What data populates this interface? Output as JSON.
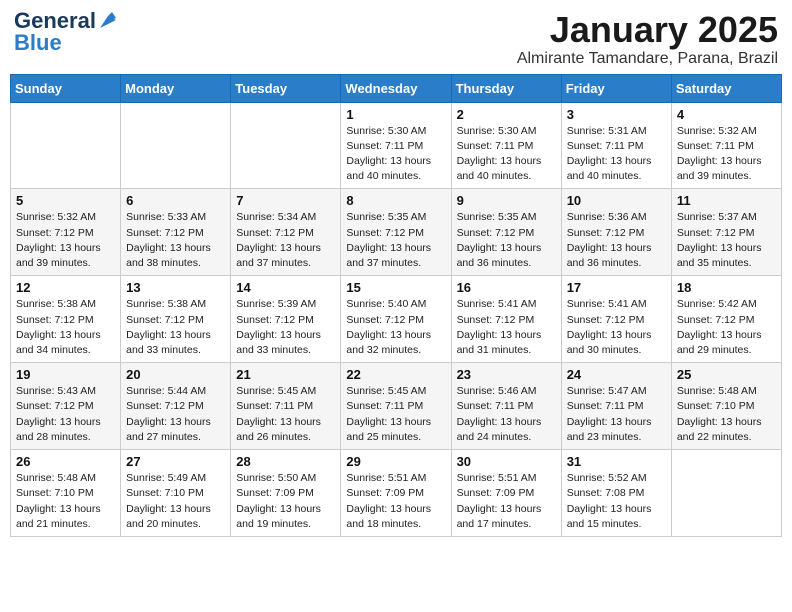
{
  "header": {
    "logo": {
      "general": "General",
      "blue": "Blue"
    },
    "title": "January 2025",
    "location": "Almirante Tamandare, Parana, Brazil"
  },
  "weekdays": [
    "Sunday",
    "Monday",
    "Tuesday",
    "Wednesday",
    "Thursday",
    "Friday",
    "Saturday"
  ],
  "weeks": [
    [
      {
        "day": "",
        "sunrise": "",
        "sunset": "",
        "daylight": ""
      },
      {
        "day": "",
        "sunrise": "",
        "sunset": "",
        "daylight": ""
      },
      {
        "day": "",
        "sunrise": "",
        "sunset": "",
        "daylight": ""
      },
      {
        "day": "1",
        "sunrise": "Sunrise: 5:30 AM",
        "sunset": "Sunset: 7:11 PM",
        "daylight": "Daylight: 13 hours and 40 minutes."
      },
      {
        "day": "2",
        "sunrise": "Sunrise: 5:30 AM",
        "sunset": "Sunset: 7:11 PM",
        "daylight": "Daylight: 13 hours and 40 minutes."
      },
      {
        "day": "3",
        "sunrise": "Sunrise: 5:31 AM",
        "sunset": "Sunset: 7:11 PM",
        "daylight": "Daylight: 13 hours and 40 minutes."
      },
      {
        "day": "4",
        "sunrise": "Sunrise: 5:32 AM",
        "sunset": "Sunset: 7:11 PM",
        "daylight": "Daylight: 13 hours and 39 minutes."
      }
    ],
    [
      {
        "day": "5",
        "sunrise": "Sunrise: 5:32 AM",
        "sunset": "Sunset: 7:12 PM",
        "daylight": "Daylight: 13 hours and 39 minutes."
      },
      {
        "day": "6",
        "sunrise": "Sunrise: 5:33 AM",
        "sunset": "Sunset: 7:12 PM",
        "daylight": "Daylight: 13 hours and 38 minutes."
      },
      {
        "day": "7",
        "sunrise": "Sunrise: 5:34 AM",
        "sunset": "Sunset: 7:12 PM",
        "daylight": "Daylight: 13 hours and 37 minutes."
      },
      {
        "day": "8",
        "sunrise": "Sunrise: 5:35 AM",
        "sunset": "Sunset: 7:12 PM",
        "daylight": "Daylight: 13 hours and 37 minutes."
      },
      {
        "day": "9",
        "sunrise": "Sunrise: 5:35 AM",
        "sunset": "Sunset: 7:12 PM",
        "daylight": "Daylight: 13 hours and 36 minutes."
      },
      {
        "day": "10",
        "sunrise": "Sunrise: 5:36 AM",
        "sunset": "Sunset: 7:12 PM",
        "daylight": "Daylight: 13 hours and 36 minutes."
      },
      {
        "day": "11",
        "sunrise": "Sunrise: 5:37 AM",
        "sunset": "Sunset: 7:12 PM",
        "daylight": "Daylight: 13 hours and 35 minutes."
      }
    ],
    [
      {
        "day": "12",
        "sunrise": "Sunrise: 5:38 AM",
        "sunset": "Sunset: 7:12 PM",
        "daylight": "Daylight: 13 hours and 34 minutes."
      },
      {
        "day": "13",
        "sunrise": "Sunrise: 5:38 AM",
        "sunset": "Sunset: 7:12 PM",
        "daylight": "Daylight: 13 hours and 33 minutes."
      },
      {
        "day": "14",
        "sunrise": "Sunrise: 5:39 AM",
        "sunset": "Sunset: 7:12 PM",
        "daylight": "Daylight: 13 hours and 33 minutes."
      },
      {
        "day": "15",
        "sunrise": "Sunrise: 5:40 AM",
        "sunset": "Sunset: 7:12 PM",
        "daylight": "Daylight: 13 hours and 32 minutes."
      },
      {
        "day": "16",
        "sunrise": "Sunrise: 5:41 AM",
        "sunset": "Sunset: 7:12 PM",
        "daylight": "Daylight: 13 hours and 31 minutes."
      },
      {
        "day": "17",
        "sunrise": "Sunrise: 5:41 AM",
        "sunset": "Sunset: 7:12 PM",
        "daylight": "Daylight: 13 hours and 30 minutes."
      },
      {
        "day": "18",
        "sunrise": "Sunrise: 5:42 AM",
        "sunset": "Sunset: 7:12 PM",
        "daylight": "Daylight: 13 hours and 29 minutes."
      }
    ],
    [
      {
        "day": "19",
        "sunrise": "Sunrise: 5:43 AM",
        "sunset": "Sunset: 7:12 PM",
        "daylight": "Daylight: 13 hours and 28 minutes."
      },
      {
        "day": "20",
        "sunrise": "Sunrise: 5:44 AM",
        "sunset": "Sunset: 7:12 PM",
        "daylight": "Daylight: 13 hours and 27 minutes."
      },
      {
        "day": "21",
        "sunrise": "Sunrise: 5:45 AM",
        "sunset": "Sunset: 7:11 PM",
        "daylight": "Daylight: 13 hours and 26 minutes."
      },
      {
        "day": "22",
        "sunrise": "Sunrise: 5:45 AM",
        "sunset": "Sunset: 7:11 PM",
        "daylight": "Daylight: 13 hours and 25 minutes."
      },
      {
        "day": "23",
        "sunrise": "Sunrise: 5:46 AM",
        "sunset": "Sunset: 7:11 PM",
        "daylight": "Daylight: 13 hours and 24 minutes."
      },
      {
        "day": "24",
        "sunrise": "Sunrise: 5:47 AM",
        "sunset": "Sunset: 7:11 PM",
        "daylight": "Daylight: 13 hours and 23 minutes."
      },
      {
        "day": "25",
        "sunrise": "Sunrise: 5:48 AM",
        "sunset": "Sunset: 7:10 PM",
        "daylight": "Daylight: 13 hours and 22 minutes."
      }
    ],
    [
      {
        "day": "26",
        "sunrise": "Sunrise: 5:48 AM",
        "sunset": "Sunset: 7:10 PM",
        "daylight": "Daylight: 13 hours and 21 minutes."
      },
      {
        "day": "27",
        "sunrise": "Sunrise: 5:49 AM",
        "sunset": "Sunset: 7:10 PM",
        "daylight": "Daylight: 13 hours and 20 minutes."
      },
      {
        "day": "28",
        "sunrise": "Sunrise: 5:50 AM",
        "sunset": "Sunset: 7:09 PM",
        "daylight": "Daylight: 13 hours and 19 minutes."
      },
      {
        "day": "29",
        "sunrise": "Sunrise: 5:51 AM",
        "sunset": "Sunset: 7:09 PM",
        "daylight": "Daylight: 13 hours and 18 minutes."
      },
      {
        "day": "30",
        "sunrise": "Sunrise: 5:51 AM",
        "sunset": "Sunset: 7:09 PM",
        "daylight": "Daylight: 13 hours and 17 minutes."
      },
      {
        "day": "31",
        "sunrise": "Sunrise: 5:52 AM",
        "sunset": "Sunset: 7:08 PM",
        "daylight": "Daylight: 13 hours and 15 minutes."
      },
      {
        "day": "",
        "sunrise": "",
        "sunset": "",
        "daylight": ""
      }
    ]
  ]
}
